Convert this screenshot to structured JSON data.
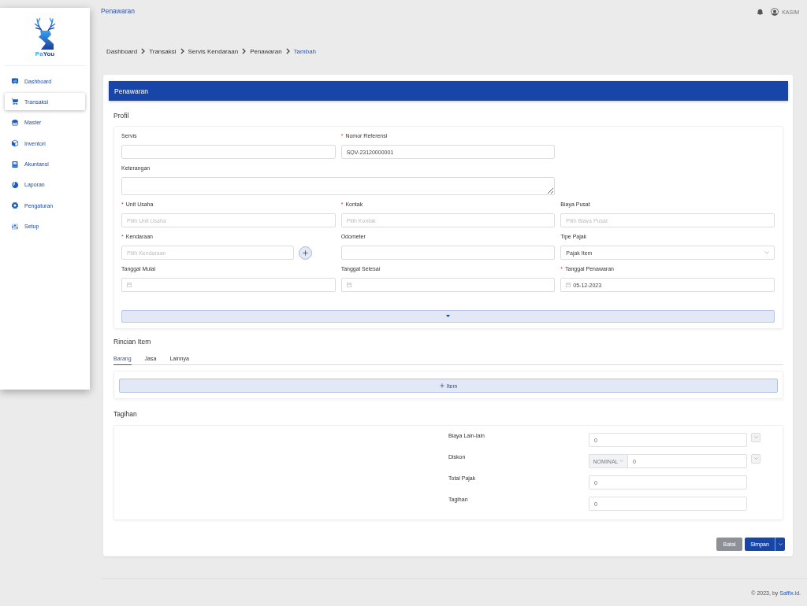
{
  "sidebar": {
    "brand": {
      "part_1": "Pa",
      "part_2": "You"
    },
    "items": [
      {
        "label": "Dashboard",
        "selected": false
      },
      {
        "label": "Transaksi",
        "selected": true
      },
      {
        "label": "Master",
        "selected": false
      },
      {
        "label": "Inventori",
        "selected": false
      },
      {
        "label": "Akuntansi",
        "selected": false
      },
      {
        "label": "Laporan",
        "selected": false
      },
      {
        "label": "Pengaturan",
        "selected": false
      },
      {
        "label": "Setup",
        "selected": false
      }
    ]
  },
  "header": {
    "title": "Penawaran",
    "user": "KASIM"
  },
  "breadcrumb": [
    {
      "label": "Dashboard",
      "current": false
    },
    {
      "label": "Transaksi",
      "current": false
    },
    {
      "label": "Servis Kendaraan",
      "current": false
    },
    {
      "label": "Penawaran",
      "current": false
    },
    {
      "label": "Tambah",
      "current": true
    }
  ],
  "panel": {
    "title": "Penawaran"
  },
  "profil": {
    "title": "Profil",
    "rows": [
      [
        {
          "label": "Servis",
          "kind": "text"
        },
        {
          "label": "Nomor Referensi",
          "required_mark": "*",
          "kind": "text",
          "value": "SQV-23120000001"
        }
      ],
      [
        {
          "label": "Keterangan",
          "kind": "textarea"
        }
      ],
      [
        {
          "label": "Unit Usaha",
          "required_mark": "*",
          "kind": "text",
          "placeholder": "Pilih Unit Usaha"
        },
        {
          "label": "Kontak",
          "required_mark": "*",
          "kind": "text",
          "placeholder": "Pilih Kontak"
        },
        {
          "label": "Biaya Pusat",
          "kind": "text",
          "placeholder": "Pilih Biaya Pusat"
        }
      ],
      [
        {
          "label": "Kendaraan",
          "required_mark": "*",
          "kind": "lookup",
          "placeholder": "Pilih Kendaraan"
        },
        {
          "label": "Odometer",
          "kind": "text"
        },
        {
          "label": "Tipe Pajak",
          "kind": "select",
          "value": "Pajak Item"
        }
      ],
      [
        {
          "label": "Tanggal Mulai",
          "kind": "date"
        },
        {
          "label": "Tanggal Selesai",
          "kind": "date"
        },
        {
          "label": "Tanggal Penawaran",
          "required_mark": "*",
          "kind": "date",
          "value": "05-12-2023"
        }
      ]
    ],
    "toggle": {
      "expanded": false
    }
  },
  "rincian_item": {
    "title": "Rincian Item",
    "tabs": [
      {
        "label": "Barang",
        "selected": true
      },
      {
        "label": "Jasa",
        "selected": false
      },
      {
        "label": "Lainnya",
        "selected": false
      }
    ],
    "add_button": "Item"
  },
  "tagihan": {
    "title": "Tagihan",
    "rows": [
      {
        "label": "Biaya Lain-lain",
        "kind": "menu",
        "value": "0"
      },
      {
        "label": "Diskon",
        "kind": "discount",
        "unit": "NOMINAL",
        "value": "0"
      },
      {
        "label": "Total Pajak",
        "kind": "plain",
        "value": "0"
      },
      {
        "label": "Tagihan",
        "kind": "plain",
        "value": "0"
      }
    ]
  },
  "actions": {
    "cancel": "Batal",
    "save": "Simpan"
  },
  "footer": {
    "text": "© 2023, by",
    "link": "Saffix.id."
  }
}
